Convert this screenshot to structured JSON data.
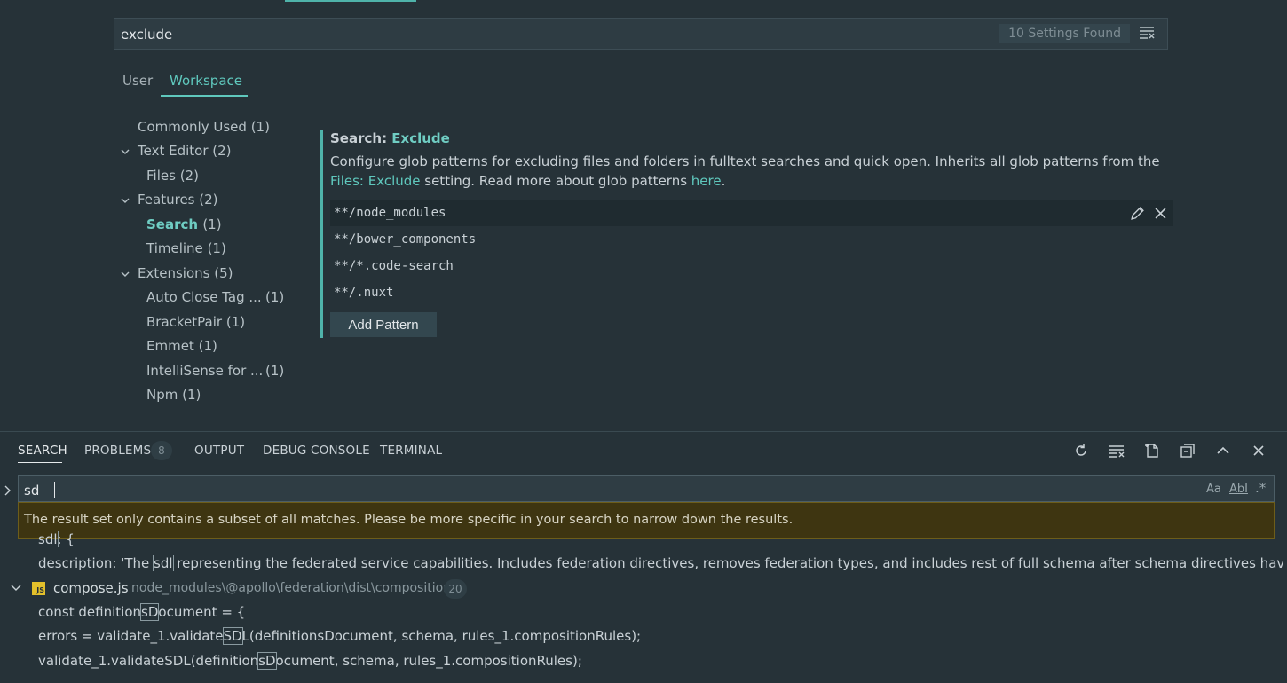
{
  "settings": {
    "search_value": "exclude",
    "found_label": "10 Settings Found",
    "tabs": {
      "user": "User",
      "workspace": "Workspace"
    },
    "toc": [
      {
        "label": "Commonly Used",
        "count": "(1)"
      },
      {
        "label": "Text Editor",
        "count": "(2)"
      },
      {
        "label": "Files",
        "count": "(2)"
      },
      {
        "label": "Features",
        "count": "(2)"
      },
      {
        "label": "Search",
        "count": "(1)"
      },
      {
        "label": "Timeline",
        "count": "(1)"
      },
      {
        "label": "Extensions",
        "count": "(5)"
      },
      {
        "label": "Auto Close Tag ...",
        "count": "(1)"
      },
      {
        "label": "BracketPair",
        "count": "(1)"
      },
      {
        "label": "Emmet",
        "count": "(1)"
      },
      {
        "label": "IntelliSense for ...",
        "count": "(1)"
      },
      {
        "label": "Npm",
        "count": "(1)"
      }
    ],
    "setting": {
      "category": "Search: ",
      "key": "Exclude",
      "desc_a": "Configure glob patterns for excluding files and folders in fulltext searches and quick open. Inherits all glob patterns from the ",
      "desc_link1": "Files: Exclude",
      "desc_b": " setting. Read more about glob patterns ",
      "desc_link2": "here",
      "desc_c": ".",
      "patterns": [
        "**/node_modules",
        "**/bower_components",
        "**/*.code-search",
        "**/.nuxt"
      ],
      "add_label": "Add Pattern"
    }
  },
  "panel": {
    "tabs": {
      "search": "SEARCH",
      "problems": "PROBLEMS",
      "problems_count": "8",
      "output": "OUTPUT",
      "debug": "DEBUG CONSOLE",
      "terminal": "TERMINAL"
    },
    "search_value": "sd",
    "options": {
      "case": "Aa",
      "word": "AbI",
      "regex": ".*"
    },
    "warning": "The result set only contains a subset of all matches. Please be more specific in your search to narrow down the results.",
    "results": {
      "r0_match": "sdl",
      "r0_rest": ": {",
      "r1_pre": "description: 'The ",
      "r1_match": "sdl",
      "r1_post": " representing the federated service capabilities. Includes federation directives, removes federation types, and includes rest of full schema after schema directives have been ap...",
      "file_icon": "JS",
      "file_name": "compose.js",
      "file_path": "node_modules\\@apollo\\federation\\dist\\composition",
      "file_count": "20",
      "r2_pre": "const definition",
      "r2_match": "sD",
      "r2_post": "ocument = {",
      "r3_pre": "errors = validate_1.validate",
      "r3_match": "SD",
      "r3_post": "L(definitionsDocument, schema, rules_1.compositionRules);",
      "r4_pre": "validate_1.validateSDL(definition",
      "r4_match": "sD",
      "r4_post": "ocument, schema, rules_1.compositionRules);"
    }
  }
}
